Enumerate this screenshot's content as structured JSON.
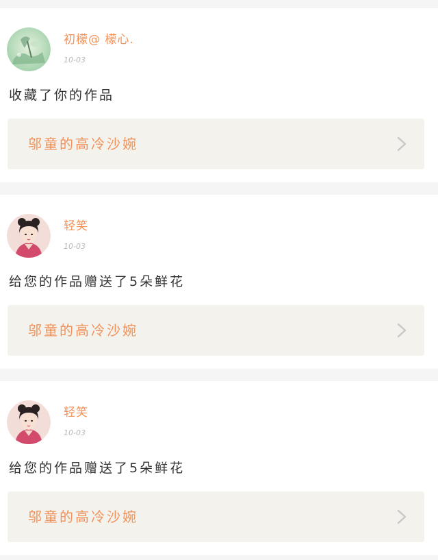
{
  "feed": {
    "items": [
      {
        "user_name": "初檬@ 檬心.",
        "date": "10-03",
        "avatar_icon": "avatar-landscape-icon",
        "message": "收藏了你的作品",
        "work_title": "邬童的高冷沙婉"
      },
      {
        "user_name": "轻笑",
        "date": "10-03",
        "avatar_icon": "avatar-portrait-icon",
        "message": "给您的作品赠送了5朵鲜花",
        "work_title": "邬童的高冷沙婉"
      },
      {
        "user_name": "轻笑",
        "date": "10-03",
        "avatar_icon": "avatar-portrait-icon",
        "message": "给您的作品赠送了5朵鲜花",
        "work_title": "邬童的高冷沙婉"
      }
    ]
  },
  "colors": {
    "accent": "#f0925a",
    "page_background": "#f5f5f5",
    "link_background": "#f3f2ec",
    "text_primary": "#333333",
    "text_secondary": "#b5b5b5",
    "chevron": "#c8c8c8"
  }
}
